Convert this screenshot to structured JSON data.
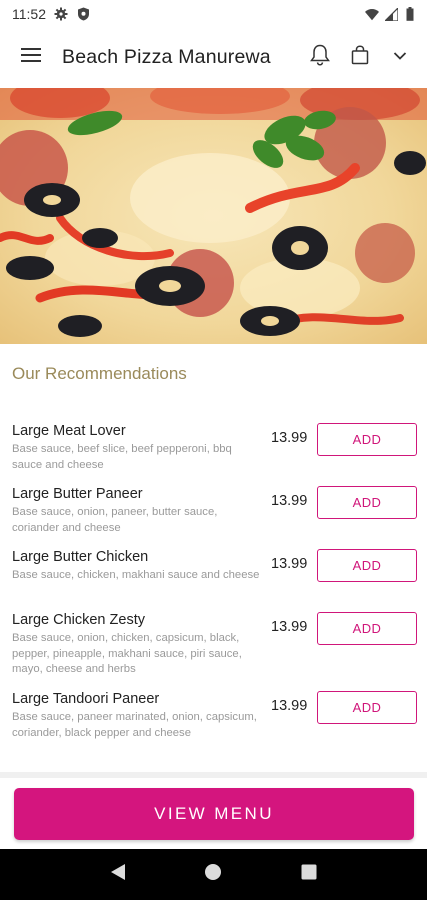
{
  "status_bar": {
    "time": "11:52"
  },
  "app_bar": {
    "title": "Beach Pizza Manurewa"
  },
  "section": {
    "title": "Our Recommendations"
  },
  "items": [
    {
      "name": "Large Meat Lover",
      "description": "Base sauce, beef slice, beef pepperoni, bbq sauce and cheese",
      "price": "13.99",
      "action": "ADD"
    },
    {
      "name": "Large Butter Paneer",
      "description": "Base sauce, onion, paneer, butter sauce, coriander and cheese",
      "price": "13.99",
      "action": "ADD"
    },
    {
      "name": "Large Butter Chicken",
      "description": "Base sauce, chicken, makhani sauce and cheese",
      "price": "13.99",
      "action": "ADD"
    },
    {
      "name": "Large Chicken Zesty",
      "description": "Base sauce, onion, chicken, capsicum, black, pepper, pineapple, makhani sauce, piri sauce, mayo, cheese and herbs",
      "price": "13.99",
      "action": "ADD"
    },
    {
      "name": "Large Tandoori Paneer",
      "description": "Base sauce, paneer marinated, onion, capsicum, coriander, black pepper and cheese",
      "price": "13.99",
      "action": "ADD"
    }
  ],
  "footer": {
    "view_menu_label": "VIEW MENU"
  },
  "colors": {
    "accent": "#d4157e",
    "section_title": "#9a8a5a",
    "muted_text": "#9a9a9a"
  },
  "icons": [
    "settings-icon",
    "shield-icon",
    "wifi-icon",
    "signal-icon",
    "battery-icon",
    "menu-icon",
    "bell-icon",
    "bag-icon",
    "chevron-down-icon",
    "back-icon",
    "home-icon",
    "recents-icon"
  ]
}
